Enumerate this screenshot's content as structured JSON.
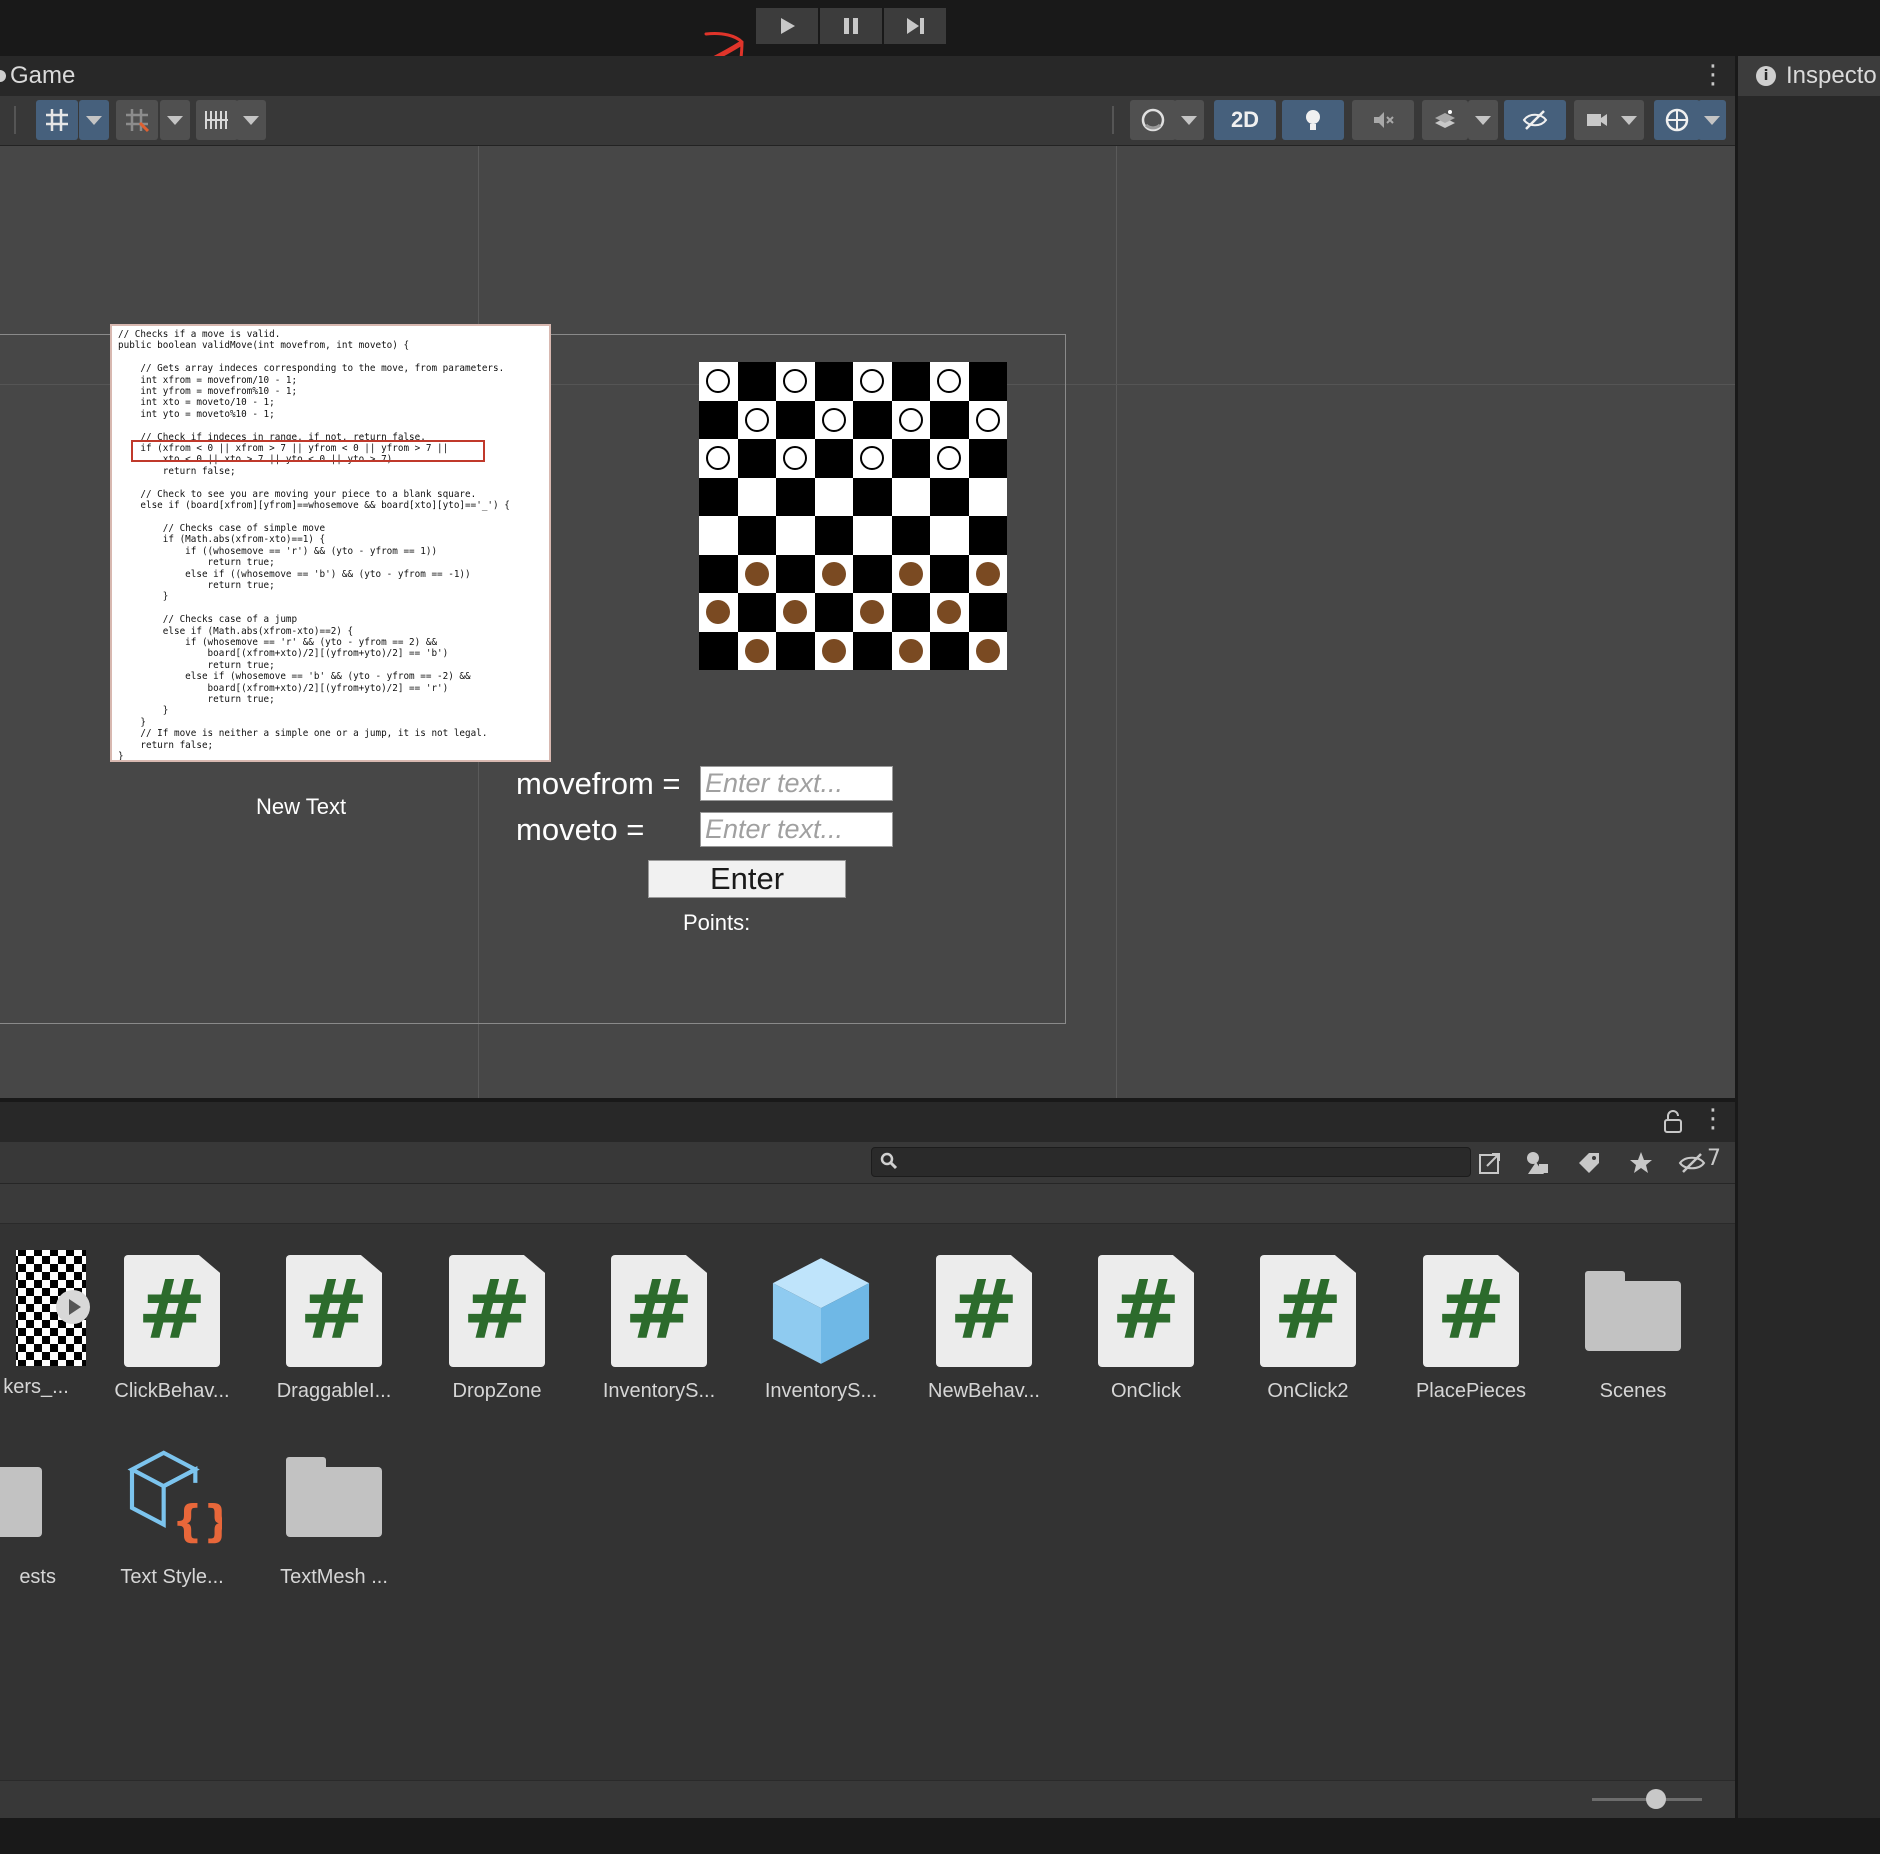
{
  "play_controls": {
    "play_icon": "play-icon",
    "pause_icon": "pause-icon",
    "step_icon": "step-icon"
  },
  "scene_window": {
    "tab_label": "Game",
    "toolbar": {
      "two_d_label": "2D"
    }
  },
  "inspector": {
    "tab_label": "Inspecto"
  },
  "game_view": {
    "code_image_text": "// Checks if a move is valid.\npublic boolean validMove(int movefrom, int moveto) {\n\n    // Gets array indeces corresponding to the move, from parameters.\n    int xfrom = movefrom/10 - 1;\n    int yfrom = movefrom%10 - 1;\n    int xto = moveto/10 - 1;\n    int yto = moveto%10 - 1;\n\n    // Check if indeces in range, if not, return false.\n    if (xfrom < 0 || xfrom > 7 || yfrom < 0 || yfrom > 7 ||\n        xto < 0 || xto > 7 || yto < 0 || yto > 7)\n        return false;\n\n    // Check to see you are moving your piece to a blank square.\n    else if (board[xfrom][yfrom]==whosemove && board[xto][yto]=='_') {\n\n        // Checks case of simple move\n        if (Math.abs(xfrom-xto)==1) {\n            if ((whosemove == 'r') && (yto - yfrom == 1))\n                return true;\n            else if ((whosemove == 'b') && (yto - yfrom == -1))\n                return true;\n        }\n\n        // Checks case of a jump\n        else if (Math.abs(xfrom-xto)==2) {\n            if (whosemove == 'r' && (yto - yfrom == 2) &&\n                board[(xfrom+xto)/2][(yfrom+yto)/2] == 'b')\n                return true;\n            else if (whosemove == 'b' && (yto - yfrom == -2) &&\n                board[(xfrom+xto)/2][(yfrom+yto)/2] == 'r')\n                return true;\n        }\n    }\n    // If move is neither a simple one or a jump, it is not legal.\n    return false;\n}",
    "new_text": "New Text",
    "movefrom_label": "movefrom =",
    "moveto_label": "moveto =",
    "input_placeholder": "Enter text...",
    "enter_label": "Enter",
    "points_label": "Points:",
    "board": {
      "rows": [
        [
          "W",
          "",
          "W",
          "",
          "W",
          "",
          "W",
          ""
        ],
        [
          "",
          "W",
          "",
          "W",
          "",
          "W",
          "",
          "W"
        ],
        [
          "W",
          "",
          "W",
          "",
          "W",
          "",
          "W",
          ""
        ],
        [
          "",
          "",
          "",
          "",
          "",
          "",
          "",
          ""
        ],
        [
          "",
          "",
          "",
          "",
          "",
          "",
          "",
          ""
        ],
        [
          "",
          "B",
          "",
          "B",
          "",
          "B",
          "",
          "B"
        ],
        [
          "B",
          "",
          "B",
          "",
          "B",
          "",
          "B",
          ""
        ],
        [
          "",
          "B",
          "",
          "B",
          "",
          "B",
          "",
          "B"
        ]
      ],
      "colors": {
        "light": "#ffffff",
        "dark": "#000000",
        "white_piece": "#ffffff",
        "brown_piece": "#7a4a22"
      }
    }
  },
  "project": {
    "hidden_count": "7",
    "assets_row1": [
      {
        "label": "kers_...",
        "type": "checker-texture"
      },
      {
        "label": "ClickBehav...",
        "type": "script"
      },
      {
        "label": "DraggableI...",
        "type": "script"
      },
      {
        "label": "DropZone",
        "type": "script"
      },
      {
        "label": "InventoryS...",
        "type": "script"
      },
      {
        "label": "InventoryS...",
        "type": "prefab"
      },
      {
        "label": "NewBehav...",
        "type": "script"
      },
      {
        "label": "OnClick",
        "type": "script"
      },
      {
        "label": "OnClick2",
        "type": "script"
      },
      {
        "label": "PlacePieces",
        "type": "script"
      },
      {
        "label": "Scenes",
        "type": "folder"
      }
    ],
    "assets_row2": [
      {
        "label": "ests",
        "type": "folder"
      },
      {
        "label": "Text Style...",
        "type": "text-style"
      },
      {
        "label": "TextMesh ...",
        "type": "folder"
      }
    ]
  }
}
